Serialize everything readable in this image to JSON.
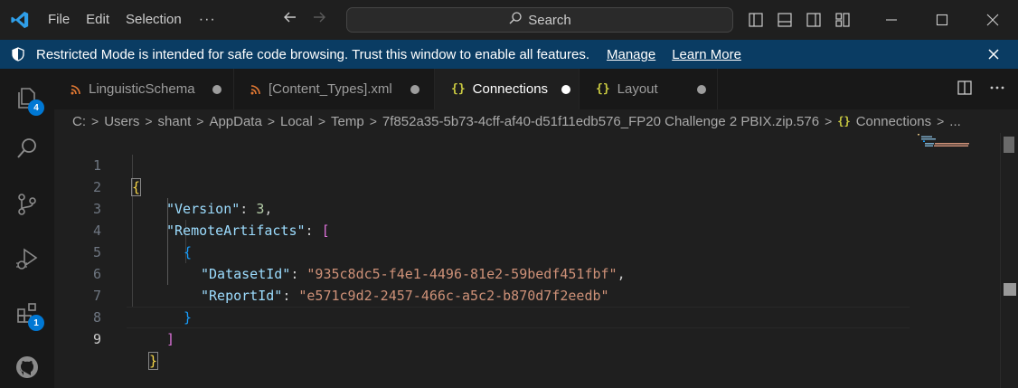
{
  "titlebar": {
    "menu": [
      "File",
      "Edit",
      "Selection"
    ],
    "more": "···",
    "search_label": "Search"
  },
  "banner": {
    "message": "Restricted Mode is intended for safe code browsing. Trust this window to enable all features.",
    "manage": "Manage",
    "learn_more": "Learn More",
    "color": "#0a3c63"
  },
  "activity": {
    "explorer_badge": "4",
    "extensions_badge": "1",
    "accent": "#0078d4"
  },
  "tabs": [
    {
      "label": "LinguisticSchema",
      "icon": "rss-icon"
    },
    {
      "label": "[Content_Types].xml",
      "icon": "rss-icon"
    },
    {
      "label": "Connections",
      "icon": "json-braces-icon"
    },
    {
      "label": "Layout",
      "icon": "json-braces-icon"
    }
  ],
  "breadcrumb": [
    "C:",
    "Users",
    "shant",
    "AppData",
    "Local",
    "Temp",
    "7f852a35-5b73-4cff-af40-d51f11edb576_FP20 Challenge 2 PBIX.zip.576",
    "Connections",
    "..."
  ],
  "editor": {
    "line_numbers": [
      "1",
      "2",
      "3",
      "4",
      "5",
      "6",
      "7",
      "8",
      "9"
    ],
    "current_line": "9",
    "code": {
      "l1_open": "{",
      "l2_key": "\"Version\"",
      "l2_sep": ": ",
      "l2_val": "3",
      "l2_end": ",",
      "l3_key": "\"RemoteArtifacts\"",
      "l3_sep": ": ",
      "l3_open": "[",
      "l4_open": "{",
      "l5_key": "\"DatasetId\"",
      "l5_sep": ": ",
      "l5_val": "\"935c8dc5-f4e1-4496-81e2-59bedf451fbf\"",
      "l5_end": ",",
      "l6_key": "\"ReportId\"",
      "l6_sep": ": ",
      "l6_val": "\"e571c9d2-2457-466c-a5c2-b870d7f2eedb\"",
      "l7_close": "}",
      "l8_close": "]",
      "l9_close": "}"
    }
  }
}
